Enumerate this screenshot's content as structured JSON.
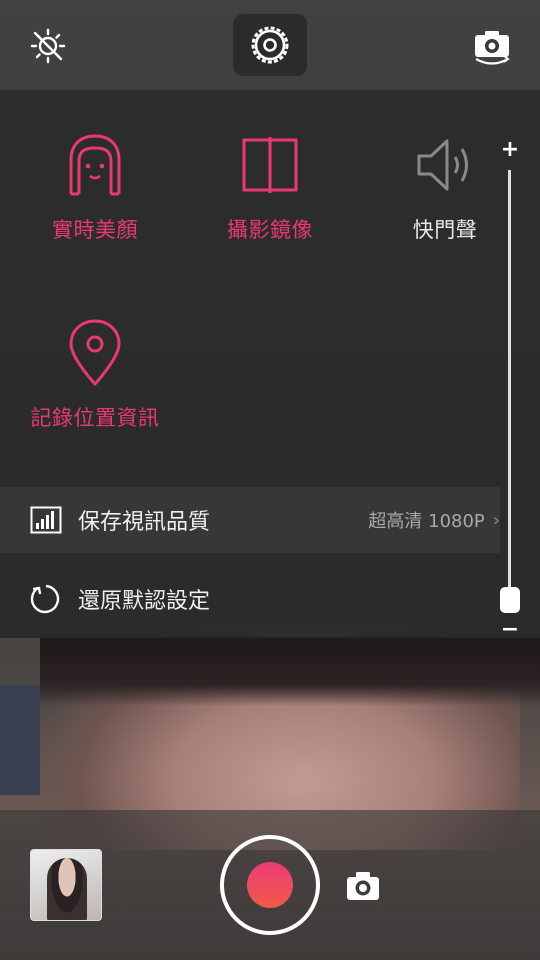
{
  "top_bar": {
    "flash_icon": "flash-off-icon",
    "settings_icon": "settings-icon",
    "switch_icon": "switch-camera-icon"
  },
  "settings": {
    "features": [
      {
        "label": "實時美顏",
        "icon": "face-beauty-icon",
        "active": true
      },
      {
        "label": "攝影鏡像",
        "icon": "mirror-icon",
        "active": true
      },
      {
        "label": "快門聲",
        "icon": "speaker-icon",
        "active": false
      },
      {
        "label": "記錄位置資訊",
        "icon": "location-pin-icon",
        "active": true
      }
    ],
    "quality": {
      "label": "保存視訊品質",
      "value": "超高清 1080P",
      "icon": "signal-bars-icon"
    },
    "reset": {
      "label": "還原默認設定",
      "icon": "reset-icon"
    }
  },
  "zoom": {
    "plus": "+",
    "minus": "−",
    "level": 0.0
  },
  "bottom_bar": {
    "thumbnail_icon": "gallery-thumbnail",
    "record_icon": "record-icon",
    "photo_icon": "camera-icon"
  },
  "colors": {
    "accent": "#e9396f",
    "inactive": "#8a8a8a"
  }
}
